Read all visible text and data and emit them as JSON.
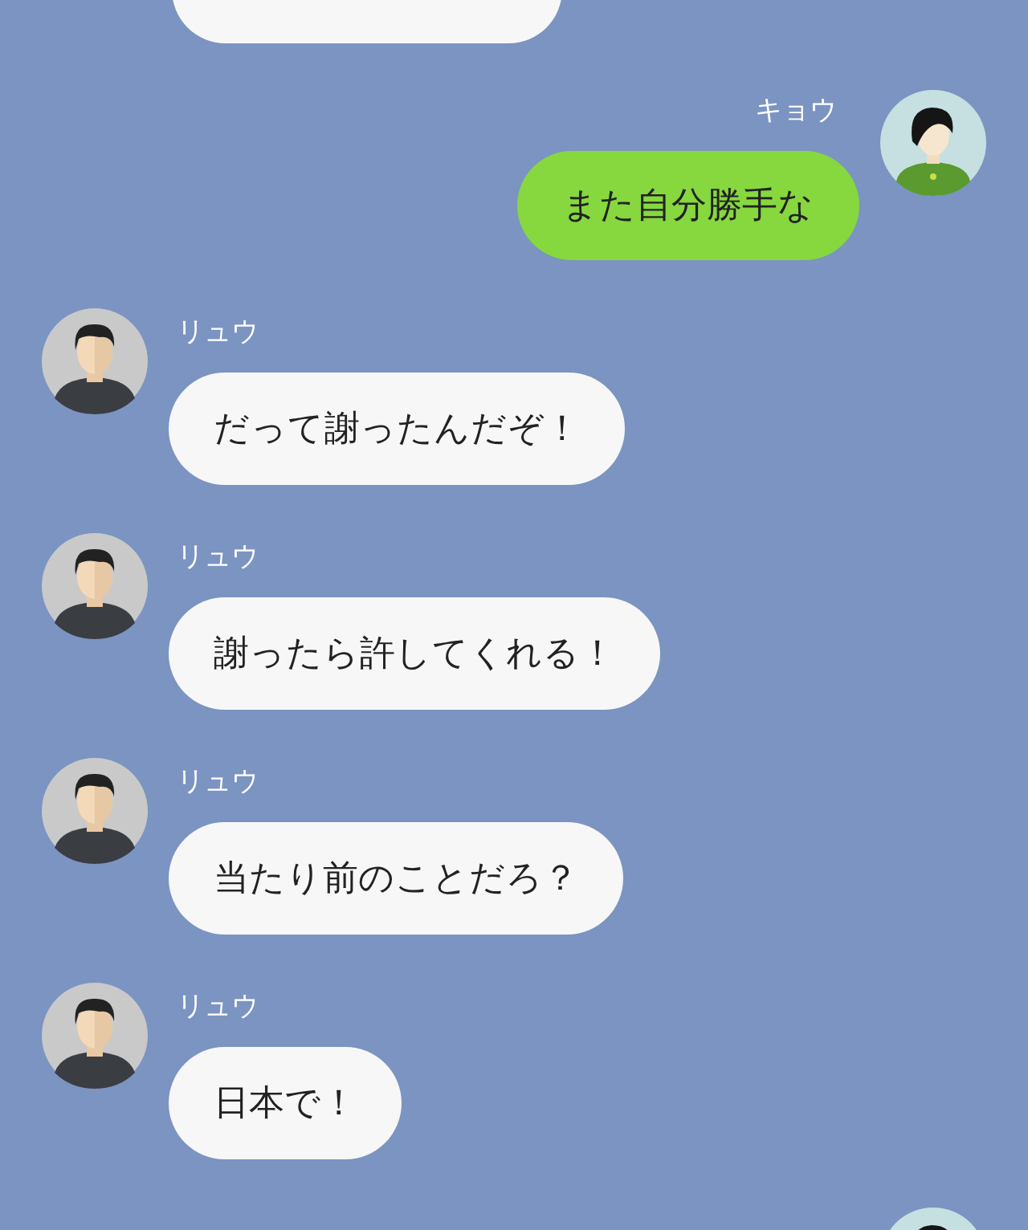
{
  "messages": [
    {
      "kind": "outgoing",
      "sender": "キョウ",
      "text": "また自分勝手な"
    },
    {
      "kind": "incoming",
      "sender": "リュウ",
      "text": "だって謝ったんだぞ！"
    },
    {
      "kind": "incoming",
      "sender": "リュウ",
      "text": "謝ったら許してくれる！"
    },
    {
      "kind": "incoming",
      "sender": "リュウ",
      "text": "当たり前のことだろ？"
    },
    {
      "kind": "incoming",
      "sender": "リュウ",
      "text": "日本で！"
    }
  ]
}
